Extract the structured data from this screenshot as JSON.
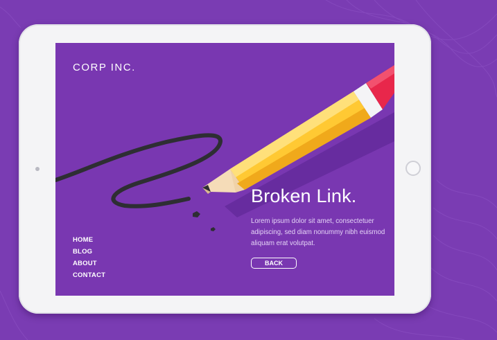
{
  "site": {
    "brand": "CORP INC."
  },
  "nav": {
    "items": [
      {
        "label": "HOME"
      },
      {
        "label": "BLOG"
      },
      {
        "label": "ABOUT"
      },
      {
        "label": "CONTACT"
      }
    ]
  },
  "error": {
    "headline": "Broken Link.",
    "message": "Lorem ipsum dolor sit amet, consectetuer adipiscing, sed diam nonummy nibh euismod aliquam erat volutpat.",
    "back_label": "BACK"
  },
  "illustration": {
    "icon": "pencil-icon",
    "scribble": "broken-scribble"
  },
  "colors": {
    "background": "#7a3cb3",
    "screen": "#7937b1",
    "pencil_body": "#ffc933",
    "eraser": "#e8274b"
  }
}
